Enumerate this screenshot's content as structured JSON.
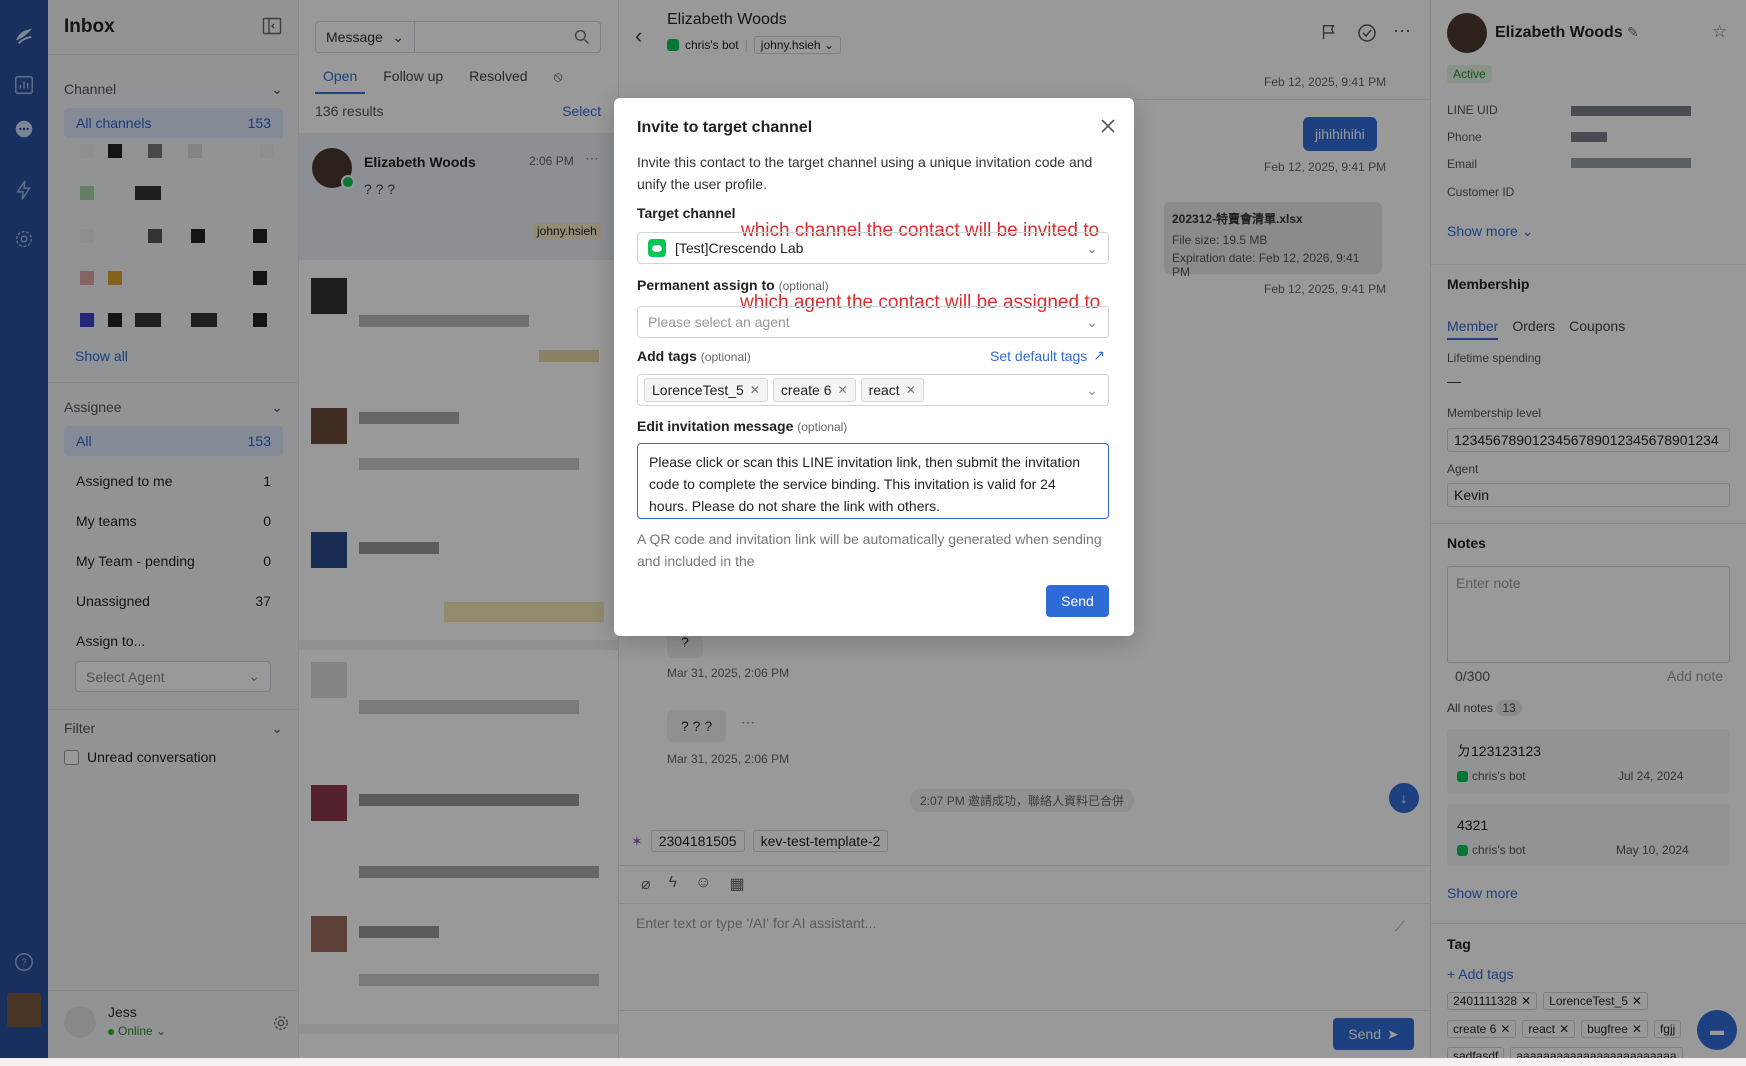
{
  "sidebar": {
    "title": "Inbox",
    "channel_header": "Channel",
    "all_channels": {
      "label": "All channels",
      "count": "153"
    },
    "show_all": "Show all",
    "assignee_header": "Assignee",
    "assignees": [
      {
        "label": "All",
        "count": "153"
      },
      {
        "label": "Assigned to me",
        "count": "1"
      },
      {
        "label": "My teams",
        "count": "0"
      },
      {
        "label": "My Team - pending",
        "count": "0"
      },
      {
        "label": "Unassigned",
        "count": "37"
      }
    ],
    "assign_to": "Assign to...",
    "select_agent": "Select Agent",
    "filter_header": "Filter",
    "unread": "Unread conversation",
    "user_name": "Jess",
    "user_status": "Online"
  },
  "list": {
    "search_type": "Message",
    "tabs": [
      "Open",
      "Follow up",
      "Resolved"
    ],
    "results": "136 results",
    "select": "Select",
    "first_conv": {
      "name": "Elizabeth Woods",
      "time": "2:06 PM",
      "preview": "? ? ?",
      "assignee": "johny.hsieh"
    }
  },
  "chat": {
    "contact_name": "Elizabeth Woods",
    "bot": "chris's bot",
    "assignee": "johny.hsieh",
    "ts1": "Feb 12, 2025, 9:41 PM",
    "bubble_out": "jihihihihi",
    "ts2": "Feb 12, 2025, 9:41 PM",
    "file_name": "202312-特賣會清單.xlsx",
    "file_size": "File size: 19.5 MB",
    "file_exp": "Expiration date: Feb 12, 2026, 9:41 PM",
    "ts3": "Feb 12, 2025, 9:41 PM",
    "bubble_q1": "?",
    "ts4": "Mar 31, 2025, 2:06 PM",
    "bubble_q3": "? ? ?",
    "ts5": "Mar 31, 2025, 2:06 PM",
    "system_msg": "2:07 PM 邀請成功，聯絡人資料已合併",
    "template_chips": [
      "2304181505",
      "kev-test-template-2"
    ],
    "composer_placeholder": "Enter text or type '/AI' for AI assistant...",
    "send": "Send"
  },
  "profile": {
    "name": "Elizabeth Woods",
    "status": "Active",
    "fields": [
      "LINE UID",
      "Phone",
      "Email",
      "Customer ID"
    ],
    "show_more": "Show more",
    "membership_title": "Membership",
    "membership_tabs": [
      "Member",
      "Orders",
      "Coupons"
    ],
    "lifetime_label": "Lifetime spending",
    "lifetime_value": "—",
    "level_label": "Membership level",
    "level_value": "1234567890123456789012345678901234",
    "agent_label": "Agent",
    "agent_value": "Kevin",
    "notes_title": "Notes",
    "note_placeholder": "Enter note",
    "note_count": "0/300",
    "add_note": "Add note",
    "all_notes": "All notes",
    "all_notes_count": "13",
    "notes": [
      {
        "text": "ㄉ123123123",
        "author": "chris's bot",
        "date": "Jul 24, 2024"
      },
      {
        "text": "4321",
        "author": "chris's bot",
        "date": "May 10, 2024"
      }
    ],
    "notes_show_more": "Show more",
    "tag_title": "Tag",
    "add_tags": "+ Add tags",
    "tags": [
      "2401111328",
      "LorenceTest_5",
      "create 6",
      "react",
      "bugfree",
      "fgjj"
    ],
    "tags_row3": [
      "sadfasdf",
      "aaaaaaaaaaaaaaaaaaaaaaaa"
    ]
  },
  "modal": {
    "title": "Invite to target channel",
    "description": "Invite this contact to the target channel using a unique invitation code and unify the user profile.",
    "target_label": "Target channel",
    "target_annotation": "which channel the contact will be invited to",
    "target_value": "[Test]Crescendo Lab",
    "assign_label": "Permanent assign to",
    "optional": "(optional)",
    "assign_annotation": "which agent the contact will be assigned to",
    "assign_placeholder": "Please select an agent",
    "tags_label": "Add tags",
    "default_tags": "Set default tags",
    "tags": [
      "LorenceTest_5",
      "create 6",
      "react"
    ],
    "message_label": "Edit invitation message",
    "message": "Please click or scan this LINE invitation link, then submit the invitation code to complete the service binding. This invitation is valid for 24 hours. Please do not share the link with others.",
    "hint": "A QR code and invitation link will be automatically generated when sending and included in the",
    "send": "Send"
  },
  "colors": {
    "accent": "#2f6bd6",
    "rail": "#2a4f9c",
    "line_green": "#06c755",
    "annotation": "#e02b2b"
  }
}
